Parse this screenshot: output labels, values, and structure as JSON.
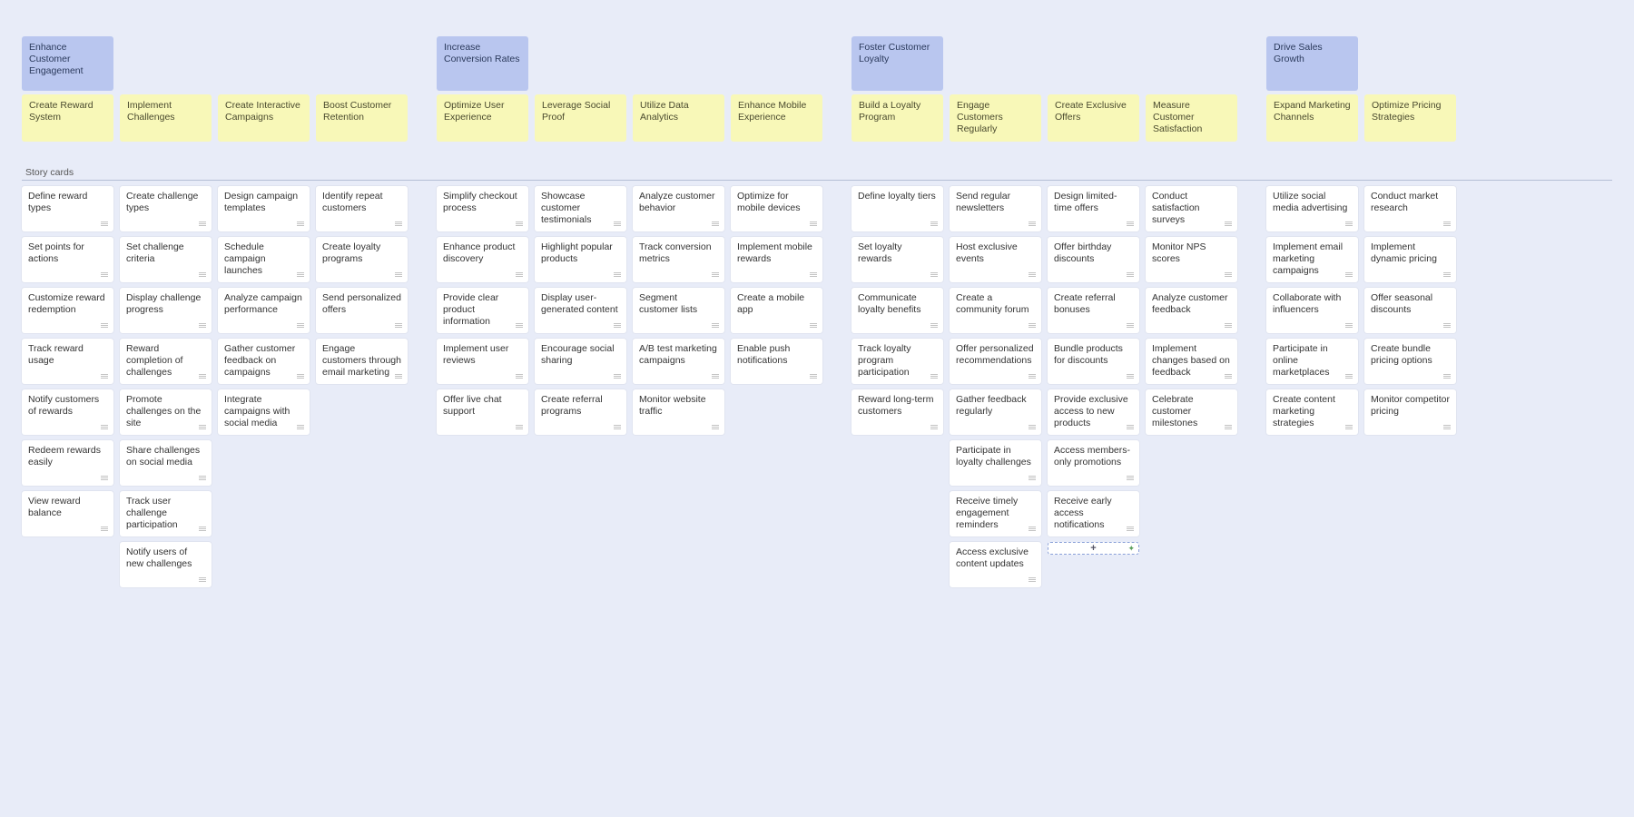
{
  "section_label": "Story cards",
  "add_card_label": "+",
  "columns": [
    {
      "epic": "Enhance Customer Engagement",
      "feature": "Create Reward System",
      "stories": [
        "Define reward types",
        "Set points for actions",
        "Customize reward redemption",
        "Track reward usage",
        "Notify customers of rewards",
        "Redeem rewards easily",
        "View reward balance"
      ]
    },
    {
      "epic": "",
      "feature": "Implement Challenges",
      "stories": [
        "Create challenge types",
        "Set challenge criteria",
        "Display challenge progress",
        "Reward completion of challenges",
        "Promote challenges on the site",
        "Share challenges on social media",
        "Track user challenge participation",
        "Notify users of new challenges"
      ]
    },
    {
      "epic": "",
      "feature": "Create Interactive Campaigns",
      "stories": [
        "Design campaign templates",
        "Schedule campaign launches",
        "Analyze campaign performance",
        "Gather customer feedback on campaigns",
        "Integrate campaigns with social media"
      ]
    },
    {
      "epic": "",
      "feature": "Boost Customer Retention",
      "stories": [
        "Identify repeat customers",
        "Create loyalty programs",
        "Send personalized offers",
        "Engage customers through email marketing"
      ]
    },
    {
      "epic": "Increase Conversion Rates",
      "feature": "Optimize User Experience",
      "stories": [
        "Simplify checkout process",
        "Enhance product discovery",
        "Provide clear product information",
        "Implement user reviews",
        "Offer live chat support"
      ]
    },
    {
      "epic": "",
      "feature": "Leverage Social Proof",
      "stories": [
        "Showcase customer testimonials",
        "Highlight popular products",
        "Display user-generated content",
        "Encourage social sharing",
        "Create referral programs"
      ]
    },
    {
      "epic": "",
      "feature": "Utilize Data Analytics",
      "stories": [
        "Analyze customer behavior",
        "Track conversion metrics",
        "Segment customer lists",
        "A/B test marketing campaigns",
        "Monitor website traffic"
      ]
    },
    {
      "epic": "",
      "feature": "Enhance Mobile Experience",
      "stories": [
        "Optimize for mobile devices",
        "Implement mobile rewards",
        "Create a mobile app",
        "Enable push notifications"
      ]
    },
    {
      "epic": "Foster Customer Loyalty",
      "feature": "Build a Loyalty Program",
      "stories": [
        "Define loyalty tiers",
        "Set loyalty rewards",
        "Communicate loyalty benefits",
        "Track loyalty program participation",
        "Reward long-term customers"
      ]
    },
    {
      "epic": "",
      "feature": "Engage Customers Regularly",
      "stories": [
        "Send regular newsletters",
        "Host exclusive events",
        "Create a community forum",
        "Offer personalized recommendations",
        "Gather feedback regularly",
        "Participate in loyalty challenges",
        "Receive timely engagement reminders",
        "Access exclusive content updates"
      ]
    },
    {
      "epic": "",
      "feature": "Create Exclusive Offers",
      "stories": [
        "Design limited-time offers",
        "Offer birthday discounts",
        "Create referral bonuses",
        "Bundle products for discounts",
        "Provide exclusive access to new products",
        "Access members-only promotions",
        "Receive early access notifications"
      ],
      "add_card": true
    },
    {
      "epic": "",
      "feature": "Measure Customer Satisfaction",
      "stories": [
        "Conduct satisfaction surveys",
        "Monitor NPS scores",
        "Analyze customer feedback",
        "Implement changes based on feedback",
        "Celebrate customer milestones"
      ]
    },
    {
      "epic": "Drive Sales Growth",
      "feature": "Expand Marketing Channels",
      "stories": [
        "Utilize social media advertising",
        "Implement email marketing campaigns",
        "Collaborate with influencers",
        "Participate in online marketplaces",
        "Create content marketing strategies"
      ]
    },
    {
      "epic": "",
      "feature": "Optimize Pricing Strategies",
      "stories": [
        "Conduct market research",
        "Implement dynamic pricing",
        "Offer seasonal discounts",
        "Create bundle pricing options",
        "Monitor competitor pricing"
      ]
    }
  ]
}
